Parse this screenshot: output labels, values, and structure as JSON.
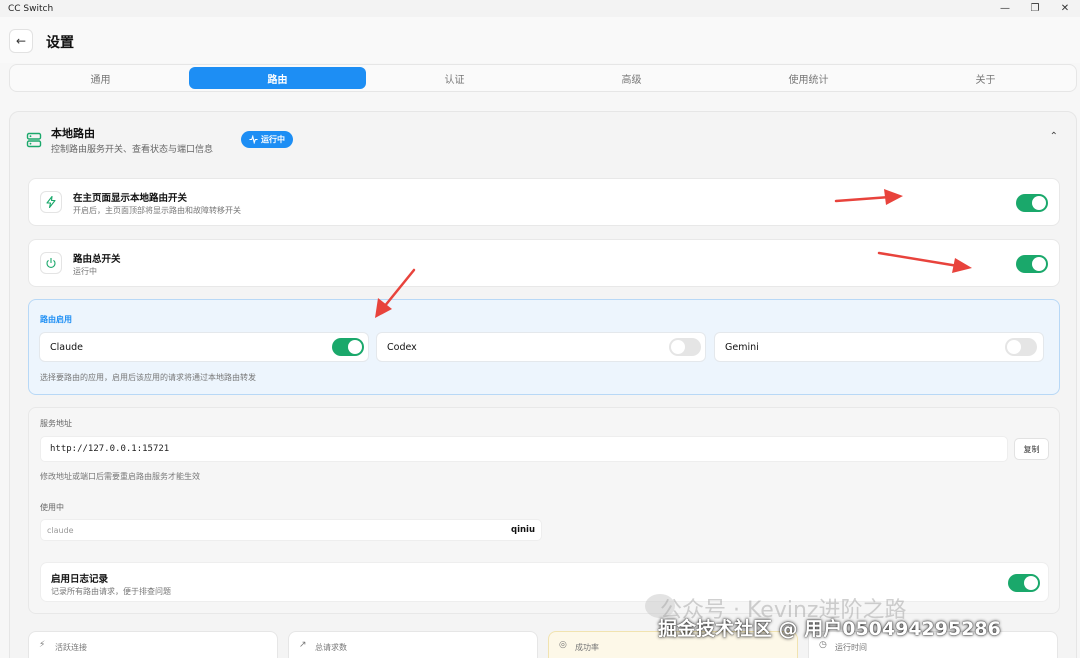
{
  "window": {
    "title": "CC Switch"
  },
  "header": {
    "title": "设置",
    "back_icon": "arrow-left-icon"
  },
  "tabs": [
    {
      "label": "通用",
      "active": false
    },
    {
      "label": "路由",
      "active": true
    },
    {
      "label": "认证",
      "active": false
    },
    {
      "label": "高级",
      "active": false
    },
    {
      "label": "使用统计",
      "active": false
    },
    {
      "label": "关于",
      "active": false
    }
  ],
  "section": {
    "title": "本地路由",
    "subtitle": "控制路由服务开关、查看状态与端口信息",
    "badge": "运行中",
    "icon": "server-icon"
  },
  "show_switch": {
    "title": "在主页面显示本地路由开关",
    "subtitle": "开启后，主页面顶部将显示路由和故障转移开关",
    "enabled": true,
    "icon": "lightning-icon"
  },
  "master_switch": {
    "title": "路由总开关",
    "subtitle": "运行中",
    "enabled": true,
    "icon": "power-icon"
  },
  "route_enable": {
    "label": "路由启用",
    "apps": [
      {
        "name": "Claude",
        "enabled": true
      },
      {
        "name": "Codex",
        "enabled": false
      },
      {
        "name": "Gemini",
        "enabled": false
      }
    ],
    "hint": "选择要路由的应用，启用后该应用的请求将通过本地路由转发"
  },
  "service": {
    "address_label": "服务地址",
    "address": "http://127.0.0.1:15721",
    "copy_label": "复制",
    "hint": "修改地址或端口后需要重启路由服务才能生效",
    "using_label": "使用中",
    "using_app": "claude",
    "using_provider": "qiniu"
  },
  "logging": {
    "title": "启用日志记录",
    "subtitle": "记录所有路由请求，便于排查问题",
    "enabled": true
  },
  "stats": [
    {
      "label": "活跃连接",
      "icon": "activity-icon"
    },
    {
      "label": "总请求数",
      "icon": "trend-icon"
    },
    {
      "label": "成功率",
      "icon": "check-circle-icon"
    },
    {
      "label": "运行时间",
      "icon": "clock-icon"
    }
  ],
  "colors": {
    "accent": "#1d8ef4",
    "toggle_on": "#1aa86b",
    "arrow": "#e8433c"
  },
  "watermarks": {
    "wechat": "公众号 · Kevinz进阶之路",
    "juejin": "掘金技术社区 @ 用户050494295286"
  }
}
